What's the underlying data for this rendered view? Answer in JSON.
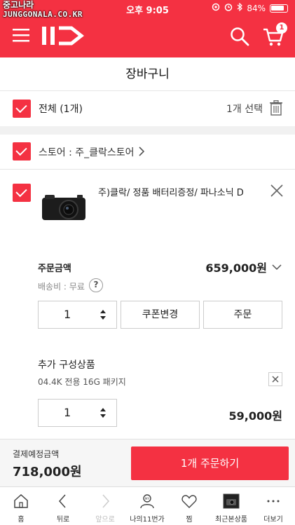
{
  "status_bar": {
    "watermark_line1": "중고나라",
    "watermark_line2": "JUNGGONALA.CO.KR",
    "time": "오후 9:05",
    "battery": "84%"
  },
  "header": {
    "logo": "11",
    "cart_count": "1"
  },
  "page": {
    "title": "장바구니"
  },
  "select_all": {
    "label": "전체 (1개)",
    "count_text": "1개 선택"
  },
  "store": {
    "label": "스토어 : 주_클락스토어"
  },
  "item": {
    "name": "주)클락/ 정품 배터리증정/ 파나소닉 D",
    "price_label": "주문금액",
    "price": "659,000원",
    "shipping": "배송비 : 무료",
    "quantity": "1",
    "coupon_label": "쿠폰변경",
    "order_label": "주문"
  },
  "option": {
    "title": "추가 구성상품",
    "name": "04.4K 전용 16G 패키지",
    "quantity": "1",
    "price": "59,000원"
  },
  "summary": {
    "label": "결제예정금액",
    "total": "718,000원",
    "order_button": "1개 주문하기"
  },
  "tabbar": {
    "tabs": [
      {
        "label": "홈",
        "icon": "home-icon"
      },
      {
        "label": "뒤로",
        "icon": "back-icon"
      },
      {
        "label": "앞으로",
        "icon": "forward-icon"
      },
      {
        "label": "나의11번가",
        "icon": "my-icon"
      },
      {
        "label": "찜",
        "icon": "heart-icon"
      },
      {
        "label": "최근본상품",
        "icon": "recent-icon"
      },
      {
        "label": "더보기",
        "icon": "more-icon"
      }
    ]
  },
  "colors": {
    "accent": "#f43142"
  }
}
